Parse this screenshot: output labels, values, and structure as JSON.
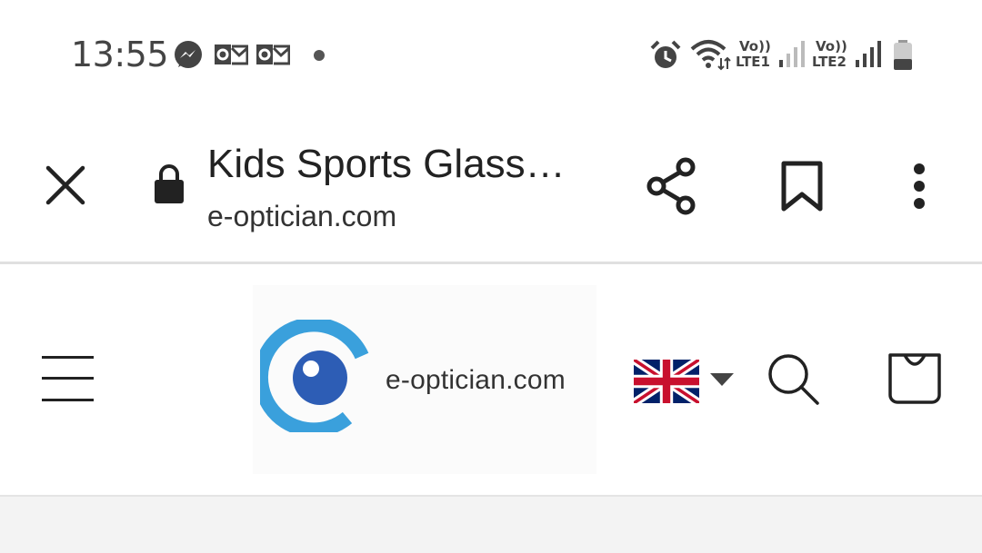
{
  "status_bar": {
    "time": "13:55",
    "icons": [
      "messenger-icon",
      "outlook-icon",
      "outlook-icon",
      "dot-icon",
      "alarm-icon",
      "wifi-icon",
      "signal-icon",
      "signal-icon",
      "battery-icon"
    ],
    "sim1_volte": "Vo))",
    "sim1_lte": "LTE1",
    "sim2_volte": "Vo))",
    "sim2_lte": "LTE2"
  },
  "browser": {
    "title": "Kids Sports Glass…",
    "domain": "e-optician.com",
    "icons": [
      "close-icon",
      "lock-icon",
      "share-icon",
      "bookmark-icon",
      "more-icon"
    ]
  },
  "site_header": {
    "logo_text": "e-optician.com",
    "icons": [
      "hamburger-menu-icon",
      "uk-flag-icon",
      "dropdown-arrow-icon",
      "search-icon",
      "cart-bag-icon"
    ]
  },
  "colors": {
    "logo_blue": "#3aa0dc",
    "logo_pupil": "#2d5db5",
    "divider": "#e0e0e0"
  }
}
